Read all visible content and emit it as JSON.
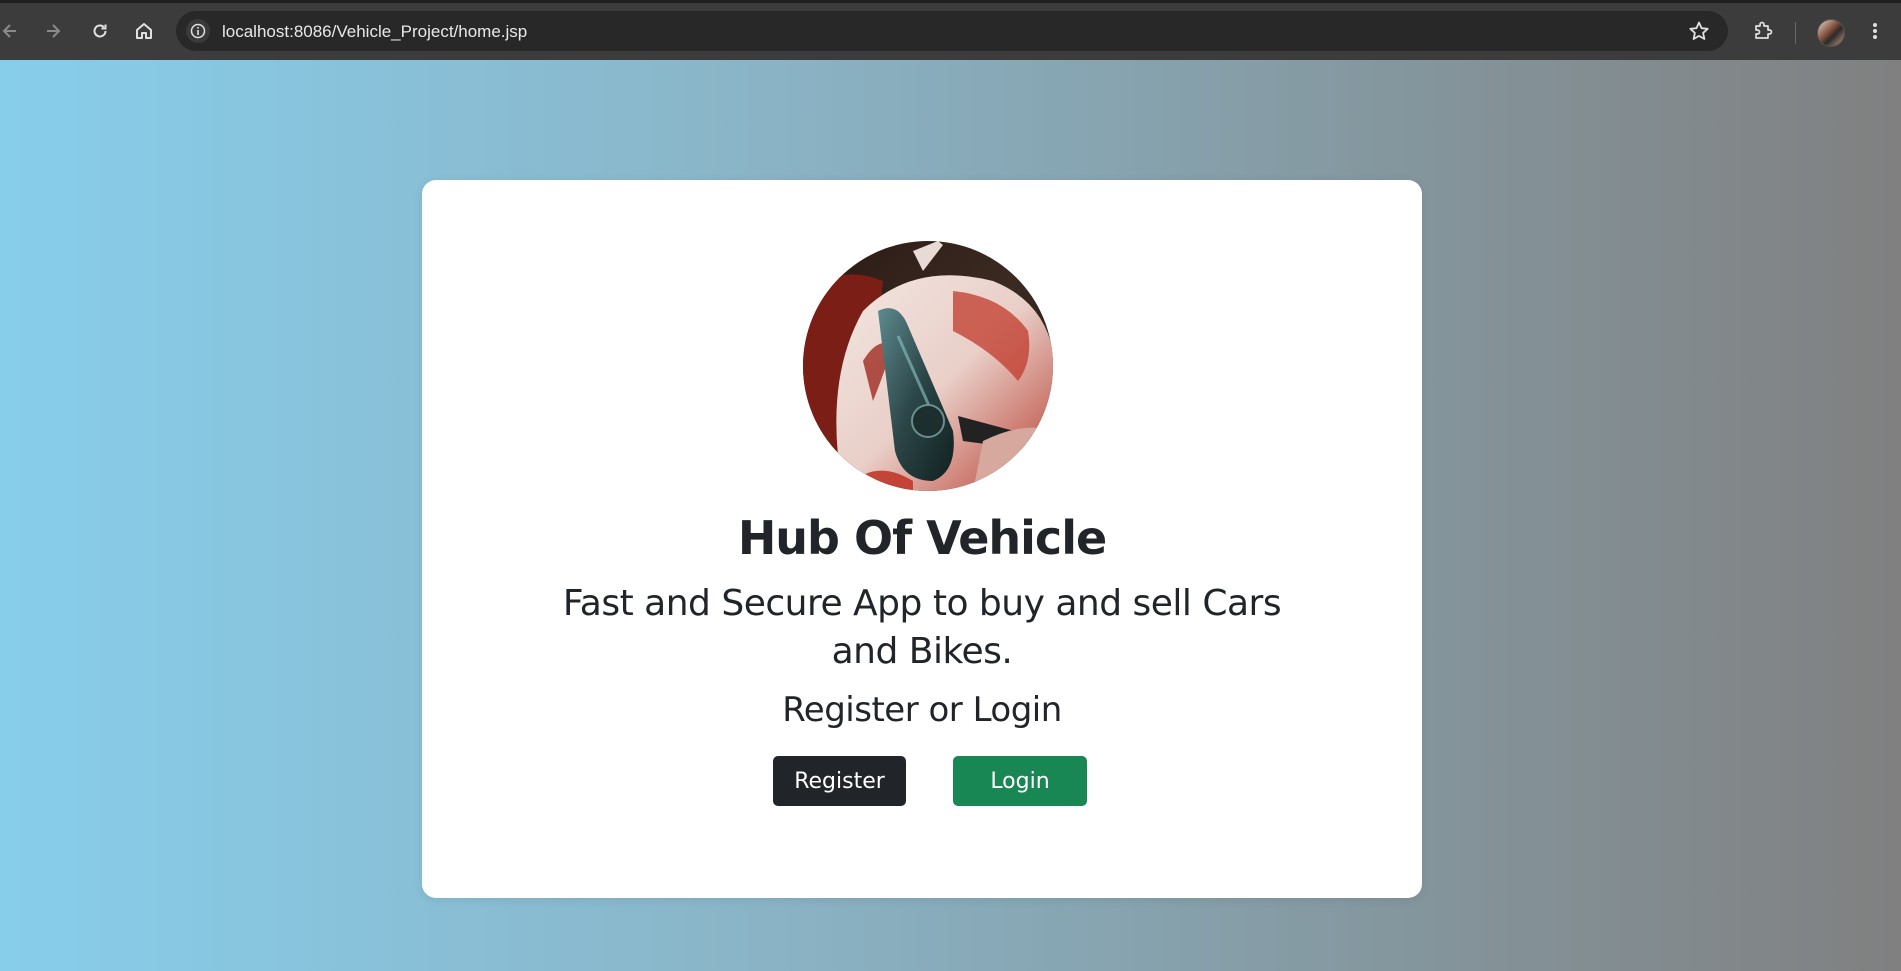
{
  "browser": {
    "url": "localhost:8086/Vehicle_Project/home.jsp",
    "icons": [
      "back-arrow-icon",
      "forward-arrow-icon",
      "reload-icon",
      "home-icon",
      "site-info-icon",
      "bookmark-star-icon",
      "extensions-puzzle-icon",
      "profile-avatar",
      "more-menu-icon"
    ]
  },
  "card": {
    "logo_alt": "red sports car headlight",
    "title": "Hub Of Vehicle",
    "subtitle": "Fast and Secure App to buy and sell Cars and Bikes.",
    "prompt": "Register or Login",
    "register_label": "Register",
    "login_label": "Login"
  },
  "colors": {
    "register_button": "#212529",
    "login_button": "#198754",
    "background_start": "#87ceeb",
    "background_end": "#808080"
  }
}
